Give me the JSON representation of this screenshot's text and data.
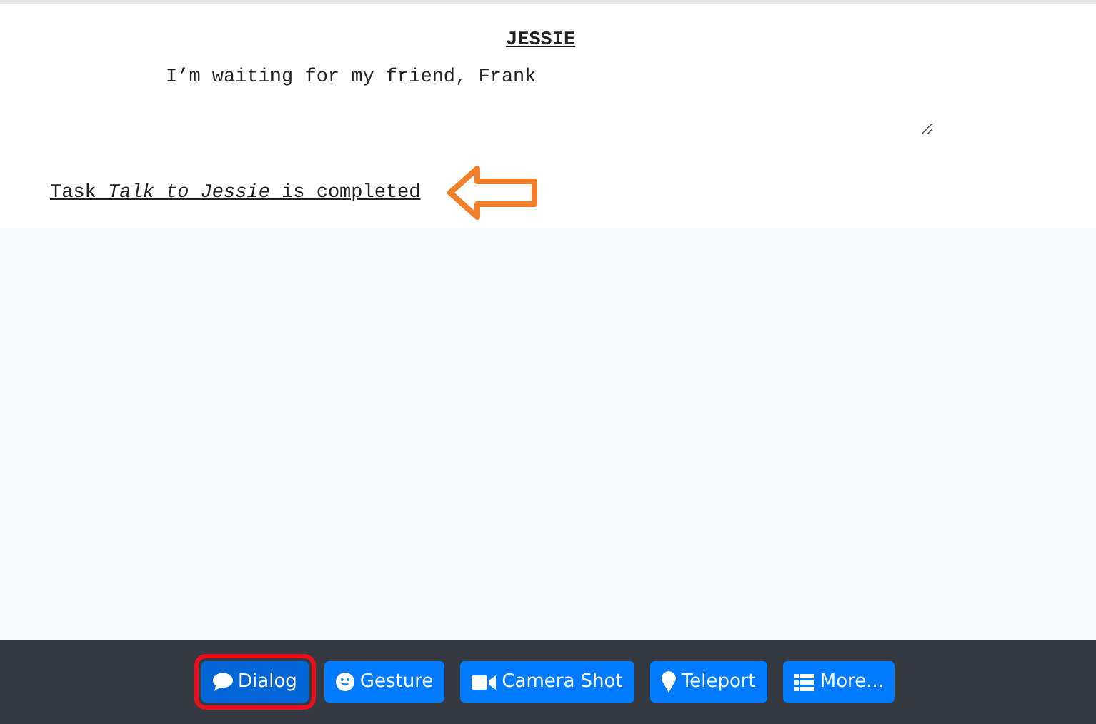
{
  "script": {
    "character": "JESSIE",
    "dialogue": "I’m waiting for my friend, Frank",
    "task_message": "Task *Talk to Jessie* is completed",
    "annotation": {
      "kind": "arrow"
    }
  },
  "toolbar": [
    {
      "label": "Dialog",
      "kind": "speech",
      "selected": true
    },
    {
      "label": "Gesture",
      "kind": "smile",
      "selected": false
    },
    {
      "label": "Camera Shot",
      "kind": "camera",
      "selected": false
    },
    {
      "label": "Teleport",
      "kind": "pin",
      "selected": false
    },
    {
      "label": "More...",
      "kind": "list",
      "selected": false
    }
  ]
}
